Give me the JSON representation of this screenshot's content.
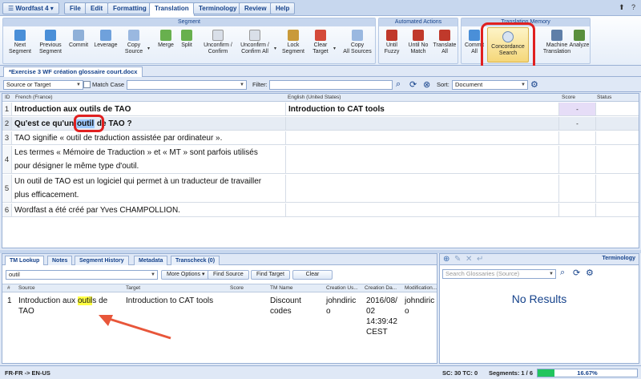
{
  "menubar": {
    "app_button": "☰ Wordfast 4 ▾",
    "tabs": [
      "File",
      "Edit",
      "Formatting",
      "Translation",
      "Terminology",
      "Review",
      "Help"
    ],
    "active_tab": "Translation",
    "window_icons": "⬆ ?"
  },
  "ribbon": {
    "groups": {
      "segment": "Segment",
      "automated": "Automated Actions",
      "tm": "Translation Memory"
    },
    "buttons": {
      "next": [
        "Next",
        "Segment"
      ],
      "prev": [
        "Previous",
        "Segment"
      ],
      "commit": [
        "Commit"
      ],
      "leverage": [
        "Leverage"
      ],
      "copy_source": [
        "Copy",
        "Source"
      ],
      "merge": [
        "Merge"
      ],
      "split": [
        "Split"
      ],
      "unconfirm": [
        "Unconfirm /",
        "Confirm"
      ],
      "unconfirm_all": [
        "Unconfirm /",
        "Confirm All"
      ],
      "lock": [
        "Lock",
        "Segment"
      ],
      "clear_target": [
        "Clear",
        "Target"
      ],
      "copy_all": [
        "Copy",
        "All Sources"
      ],
      "until_fuzzy": [
        "Until",
        "Fuzzy"
      ],
      "until_no_match": [
        "Until No",
        "Match"
      ],
      "translate_all": [
        "Translate",
        "All"
      ],
      "commit_all": [
        "Commit",
        "All"
      ],
      "concordance": [
        "Concordance",
        "Search"
      ],
      "machine": [
        "Machine",
        "Translation"
      ],
      "analyze": [
        "Analyze"
      ]
    }
  },
  "document_tab": "*Exercise 3 WF création glossaire court.docx",
  "filter": {
    "scope": "Source or Target",
    "match_case": "Match Case",
    "filter_label": "Filter:",
    "sort_label": "Sort:",
    "sort_value": "Document"
  },
  "grid": {
    "headers": {
      "id": "ID",
      "source": "French (France)",
      "target": "English (United States)",
      "score": "Score",
      "status": "Status"
    },
    "rows": [
      {
        "id": "1",
        "source": "Introduction aux outils de TAO",
        "target": "Introduction to CAT tools",
        "score": "-"
      },
      {
        "id": "2",
        "source_pre": "Qu'est ce qu'un ",
        "source_hl": "outil",
        "source_post": " de TAO ?",
        "target": "",
        "score": "-"
      },
      {
        "id": "3",
        "source": "TAO signifie « outil de traduction assistée par ordinateur ».",
        "target": "",
        "score": ""
      },
      {
        "id": "4",
        "source_l1": "Les termes « Mémoire de Traduction » et « MT » sont parfois utilisés",
        "source_l2": "pour désigner le même type d'outil.",
        "target": "",
        "score": ""
      },
      {
        "id": "5",
        "source_l1": "Un outil de TAO est un logiciel qui permet à un traducteur de travailler",
        "source_l2": "plus efficacement.",
        "target": "",
        "score": ""
      },
      {
        "id": "6",
        "source": "Wordfast a été créé par Yves CHAMPOLLION.",
        "target": "",
        "score": ""
      }
    ]
  },
  "tm_panel": {
    "tabs": [
      "TM Lookup",
      "Notes",
      "Segment History",
      "Metadata",
      "Transcheck (0)"
    ],
    "search_value": "outil",
    "buttons": {
      "more": "More Options ▾",
      "find_source": "Find Source",
      "find_target": "Find Target",
      "clear": "Clear"
    },
    "headers": {
      "num": "#",
      "source": "Source",
      "target": "Target",
      "score": "Score",
      "tm_name": "TM Name",
      "creation_user": "Creation Us...",
      "creation_date": "Creation Da...",
      "modification": "Modification..."
    },
    "result": {
      "num": "1",
      "source_pre": "Introduction aux ",
      "source_hl": "outil",
      "source_post": "s de",
      "source_l2": "TAO",
      "target": "Introduction to CAT tools",
      "tm_name_l1": "Discount",
      "tm_name_l2": "codes",
      "user_l1": "johndiric",
      "user_l2": "o",
      "date_l1": "2016/08/",
      "date_l2": "02",
      "date_l3": "14:39:42",
      "date_l4": "CEST",
      "mod_l1": "johndiric",
      "mod_l2": "o"
    }
  },
  "term_panel": {
    "title": "Terminology",
    "search_placeholder": "Search Glossaries (Source)",
    "no_results": "No Results"
  },
  "status": {
    "lang": "FR-FR -> EN-US",
    "sc_tc": "SC: 30 TC: 0",
    "segments": "Segments: 1 / 6",
    "progress_text": "16.67%",
    "progress": 16.67
  },
  "colors": {
    "accent": "#15428b",
    "highlight_circle": "#e02020",
    "progress": "#22c55e"
  }
}
